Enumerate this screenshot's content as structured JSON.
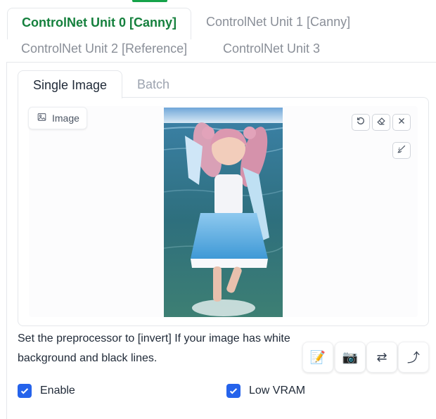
{
  "unit_tabs": [
    {
      "label": "ControlNet Unit 0 [Canny]",
      "active": true
    },
    {
      "label": "ControlNet Unit 1 [Canny]",
      "active": false
    },
    {
      "label": "ControlNet Unit 2 [Reference]",
      "active": false
    },
    {
      "label": "ControlNet Unit 3",
      "active": false
    }
  ],
  "image_tabs": [
    {
      "label": "Single Image",
      "active": true
    },
    {
      "label": "Batch",
      "active": false
    }
  ],
  "image_panel": {
    "label": "Image",
    "label_icon": "image-icon",
    "tools": [
      "undo-icon",
      "eraser-icon",
      "close-icon",
      "brush-icon"
    ]
  },
  "hint_text": "Set the preprocessor to [invert] If your image has white background and black lines.",
  "actions": [
    {
      "name": "edit-button",
      "glyph": "📝",
      "icon": "memo-icon"
    },
    {
      "name": "webcam-button",
      "glyph": "📷",
      "icon": "camera-icon"
    },
    {
      "name": "swap-button",
      "glyph": "⇄",
      "icon": "swap-arrows-icon"
    },
    {
      "name": "send-dimensions-button",
      "glyph": "⤴",
      "icon": "curved-arrow-icon"
    }
  ],
  "checkboxes": {
    "enable": {
      "label": "Enable",
      "checked": true
    },
    "low_vram": {
      "label": "Low VRAM",
      "checked": true
    }
  },
  "colors": {
    "accent_green": "#15803d",
    "checkbox_blue": "#2563eb"
  }
}
